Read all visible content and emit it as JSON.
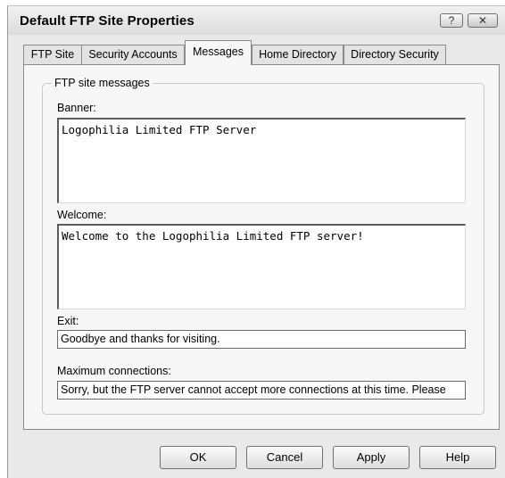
{
  "window": {
    "title": "Default FTP Site Properties",
    "help_button": "?",
    "close_button": "✕"
  },
  "tabs": [
    {
      "label": "FTP Site",
      "active": false
    },
    {
      "label": "Security Accounts",
      "active": false
    },
    {
      "label": "Messages",
      "active": true
    },
    {
      "label": "Home Directory",
      "active": false
    },
    {
      "label": "Directory Security",
      "active": false
    }
  ],
  "messages": {
    "group_title": "FTP site messages",
    "banner": {
      "label": "Banner:",
      "value": "Logophilia Limited FTP Server"
    },
    "welcome": {
      "label": "Welcome:",
      "value": "Welcome to the Logophilia Limited FTP server!"
    },
    "exit": {
      "label": "Exit:",
      "value": "Goodbye and thanks for visiting."
    },
    "max_connections": {
      "label": "Maximum connections:",
      "value": "Sorry, but the FTP server cannot accept more connections at this time. Please"
    }
  },
  "buttons": {
    "ok": "OK",
    "cancel": "Cancel",
    "apply": "Apply",
    "help": "Help"
  }
}
